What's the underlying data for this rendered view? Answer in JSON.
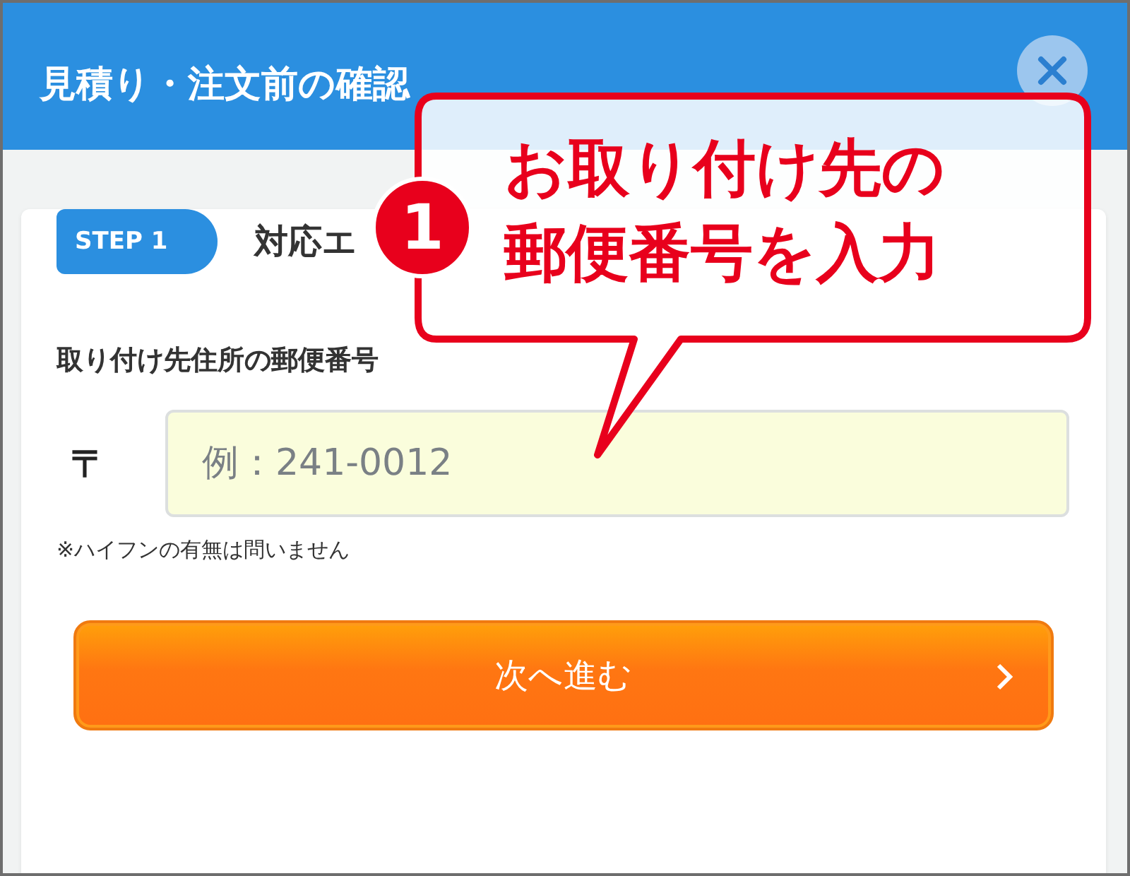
{
  "dialog": {
    "title": "見積り・注文前の確認"
  },
  "step": {
    "badge": "STEP 1",
    "title": "対応エ"
  },
  "postal_field": {
    "label": "取り付け先住所の郵便番号",
    "symbol": "〒",
    "placeholder": "例：241-0012",
    "note": "※ハイフンの有無は問いません"
  },
  "next_button": {
    "label": "次へ進む"
  },
  "annotation": {
    "number": "1",
    "lines": [
      "お取り付け先の",
      "郵便番号を入力"
    ]
  }
}
